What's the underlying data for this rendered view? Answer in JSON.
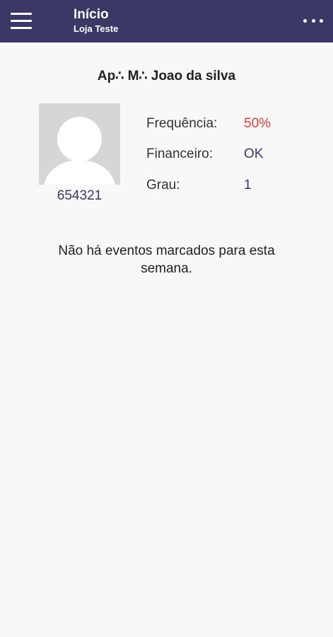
{
  "header": {
    "title": "Início",
    "subtitle": "Loja Teste",
    "menu_icon": "hamburger-menu-icon",
    "more_icon": "more-horizontal-icon",
    "background_color": "#3b3866"
  },
  "member": {
    "name": "Ap∴ M∴ Joao da silva",
    "id": "654321",
    "avatar_icon": "user-avatar-placeholder-icon"
  },
  "info": {
    "frequency_label": "Frequência:",
    "frequency_value": "50%",
    "frequency_color": "#e53935",
    "financial_label": "Financeiro:",
    "financial_value": "OK",
    "degree_label": "Grau:",
    "degree_value": "1"
  },
  "events": {
    "message": "Não há eventos marcados para esta semana."
  }
}
